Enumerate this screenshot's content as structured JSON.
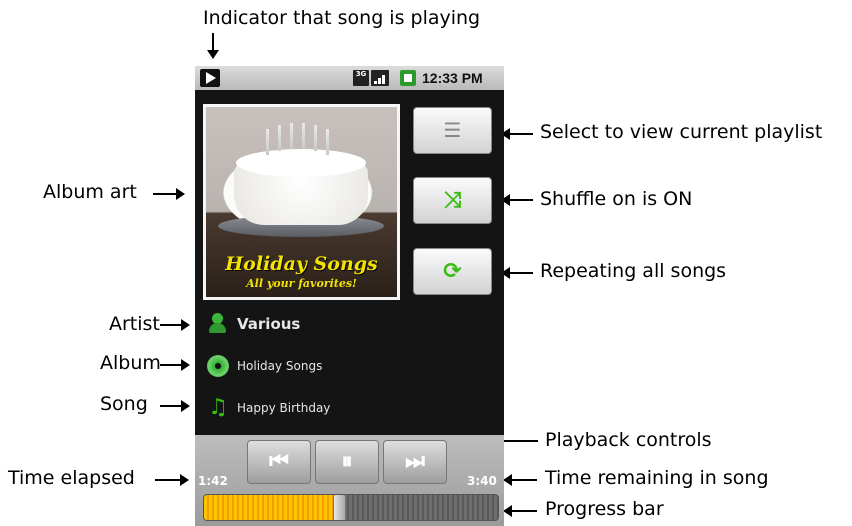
{
  "annotations": {
    "top": "Indicator that song is playing",
    "album_art": "Album art",
    "artist": "Artist",
    "album": "Album",
    "song": "Song",
    "time_elapsed": "Time elapsed",
    "playlist": "Select to view current playlist",
    "shuffle": "Shuffle on is ON",
    "repeat": "Repeating all songs",
    "playback": "Playback controls",
    "time_remaining": "Time remaining in song",
    "progress": "Progress bar"
  },
  "status_bar": {
    "network": "3G",
    "clock": "12:33 PM",
    "icons": [
      "play-indicator-icon",
      "network-3g-icon",
      "signal-icon",
      "battery-icon"
    ]
  },
  "album_art": {
    "title": "Holiday Songs",
    "subtitle": "All your favorites!"
  },
  "side_buttons": [
    {
      "name": "playlist",
      "icon": "playlist-icon",
      "glyph": "☰"
    },
    {
      "name": "shuffle",
      "icon": "shuffle-icon",
      "glyph": "⤨"
    },
    {
      "name": "repeat",
      "icon": "repeat-icon",
      "glyph": "⟳"
    }
  ],
  "track": {
    "artist": "Various",
    "album": "Holiday Songs",
    "song": "Happy Birthday"
  },
  "playback": {
    "prev_glyph": "⏮",
    "pause_glyph": "⏸",
    "next_glyph": "⏭",
    "elapsed": "1:42",
    "remaining": "3:40",
    "progress_fraction": 0.46
  },
  "colors": {
    "accent_green": "#3bbd15",
    "progress_yellow": "#ffc400",
    "art_text_yellow": "#f4e300"
  }
}
